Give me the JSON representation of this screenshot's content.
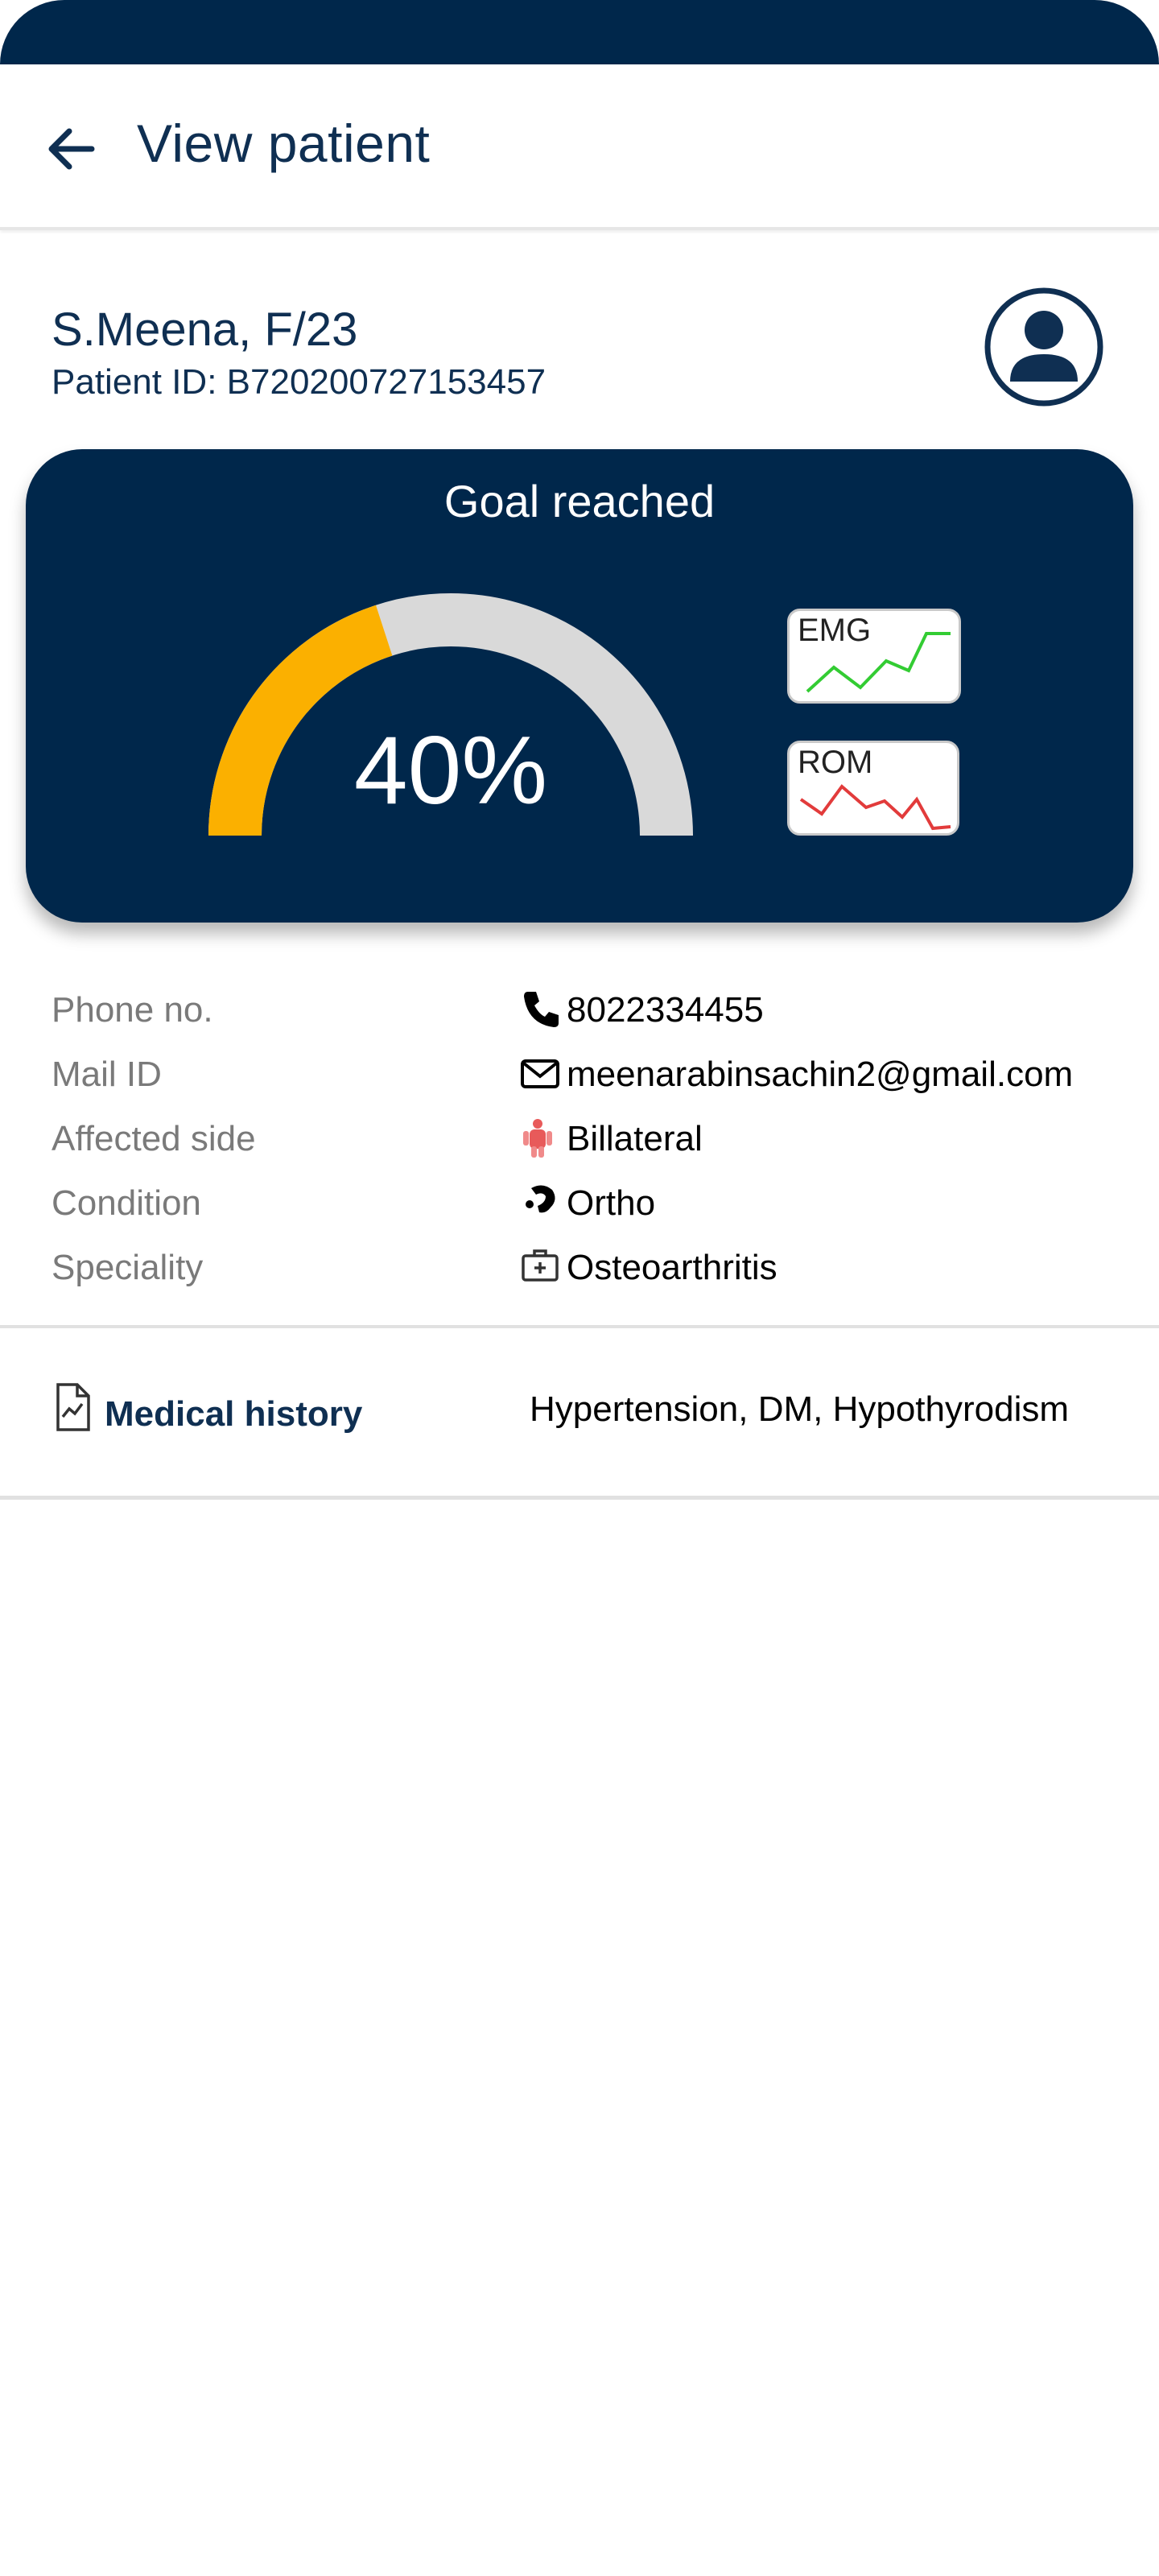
{
  "header": {
    "title": "View patient",
    "back_icon": "arrow-left-icon"
  },
  "patient": {
    "name_line": "S.Meena, F/23",
    "id_line": "Patient ID: B720200727153457",
    "avatar_icon": "user-avatar-icon"
  },
  "goal": {
    "title": "Goal reached",
    "value_label": "40%",
    "progress_fraction": 0.4,
    "progress_color": "#fbb000",
    "track_color": "#d9d9d9",
    "card_color": "#00274b",
    "charts": [
      {
        "label": "EMG",
        "line_color": "#33cc33"
      },
      {
        "label": "ROM",
        "line_color": "#e23b3b"
      }
    ]
  },
  "info": {
    "rows": [
      {
        "label": "Phone no.",
        "value": "8022334455",
        "icon": "phone-icon"
      },
      {
        "label": "Mail ID",
        "value": "meenarabinsachin2@gmail.com",
        "icon": "mail-icon"
      },
      {
        "label": "Affected side",
        "value": "Billateral",
        "icon": "body-icon"
      },
      {
        "label": "Condition",
        "value": "Ortho",
        "icon": "bone-icon"
      },
      {
        "label": "Speciality",
        "value": "Osteoarthritis",
        "icon": "medical-kit-icon"
      }
    ]
  },
  "medical_history": {
    "label": "Medical history",
    "value": "Hypertension, DM, Hypothyrodism",
    "icon": "medical-report-icon"
  }
}
